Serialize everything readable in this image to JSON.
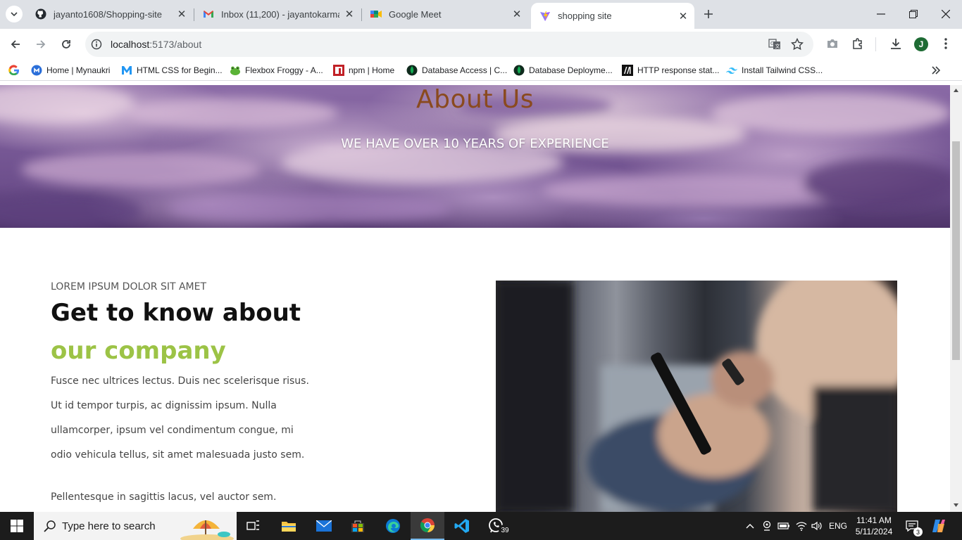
{
  "tabs": [
    {
      "title": "jayanto1608/Shopping-site",
      "icon": "github-icon"
    },
    {
      "title": "Inbox (11,200) - jayantokarmakar",
      "icon": "gmail-icon"
    },
    {
      "title": "Google Meet",
      "icon": "google-meet-icon"
    },
    {
      "title": "shopping site",
      "icon": "vite-icon",
      "active": true
    }
  ],
  "toolbar": {
    "url_host": "localhost",
    "url_path": ":5173/about",
    "profile_initial": "J"
  },
  "bookmarks": [
    {
      "label": "Home | Mynaukri",
      "icon": "mynaukri-icon"
    },
    {
      "label": "HTML CSS for Begin...",
      "icon": "m-logo-icon"
    },
    {
      "label": "Flexbox Froggy - A...",
      "icon": "frog-icon"
    },
    {
      "label": "npm | Home",
      "icon": "npm-icon"
    },
    {
      "label": "Database Access | C...",
      "icon": "mongodb-icon"
    },
    {
      "label": "Database Deployme...",
      "icon": "mongodb-icon"
    },
    {
      "label": "HTTP response stat...",
      "icon": "mdn-icon"
    },
    {
      "label": "Install Tailwind CSS...",
      "icon": "tailwind-icon"
    }
  ],
  "page": {
    "hero_title": "About Us",
    "hero_subtitle": "WE HAVE OVER 10 YEARS OF EXPERIENCE",
    "eyebrow": "LOREM IPSUM DOLOR SIT AMET",
    "heading_main": "Get to know about",
    "heading_accent": "our company",
    "paragraph_lines": [
      "Fusce nec ultrices lectus. Duis nec scelerisque risus.",
      "Ut id tempor turpis, ac dignissim ipsum. Nulla",
      "ullamcorper, ipsum vel condimentum congue, mi",
      "odio vehicula tellus, sit amet malesuada justo sem."
    ],
    "paragraph2": "Pellentesque in sagittis lacus, vel auctor sem.",
    "accent_color": "#9cc346",
    "title_color": "#8a4a1f"
  },
  "taskbar": {
    "search_placeholder": "Type here to search",
    "whatsapp_badge": "39",
    "language": "ENG",
    "time": "11:41 AM",
    "date": "5/11/2024",
    "notification_count": "3"
  }
}
